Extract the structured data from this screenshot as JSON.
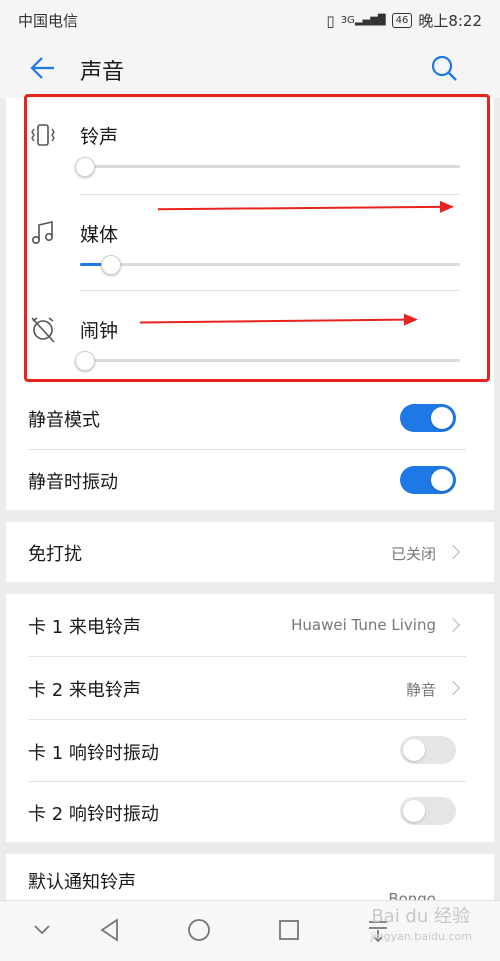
{
  "status_bar": {
    "carrier": "中国电信",
    "signal": "3G",
    "battery": "46",
    "time": "晚上8:22"
  },
  "header": {
    "title": "声音"
  },
  "volume": [
    {
      "label": "铃声",
      "icon": "vibrate-ring-icon",
      "level": 0.01
    },
    {
      "label": "媒体",
      "icon": "music-note-icon",
      "level": 0.08
    },
    {
      "label": "闹钟",
      "icon": "alarm-off-icon",
      "level": 0.01
    }
  ],
  "toggles": [
    {
      "label": "静音模式",
      "on": true
    },
    {
      "label": "静音时振动",
      "on": true
    }
  ],
  "dnd": {
    "label": "免打扰",
    "value": "已关闭"
  },
  "sim_settings": [
    {
      "label": "卡 1 来电铃声",
      "value": "Huawei Tune Living",
      "type": "link"
    },
    {
      "label": "卡 2 来电铃声",
      "value": "静音",
      "type": "link"
    },
    {
      "label": "卡 1 响铃时振动",
      "on": false,
      "type": "toggle"
    },
    {
      "label": "卡 2 响铃时振动",
      "on": false,
      "type": "toggle"
    }
  ],
  "notification": {
    "label": "默认通知铃声",
    "value": "Bongo"
  },
  "watermark": {
    "main": "Bai du 经验",
    "sub": "jingyan.baidu.com"
  },
  "colors": {
    "accent": "#1e78e6",
    "annotation": "#e8231d"
  }
}
